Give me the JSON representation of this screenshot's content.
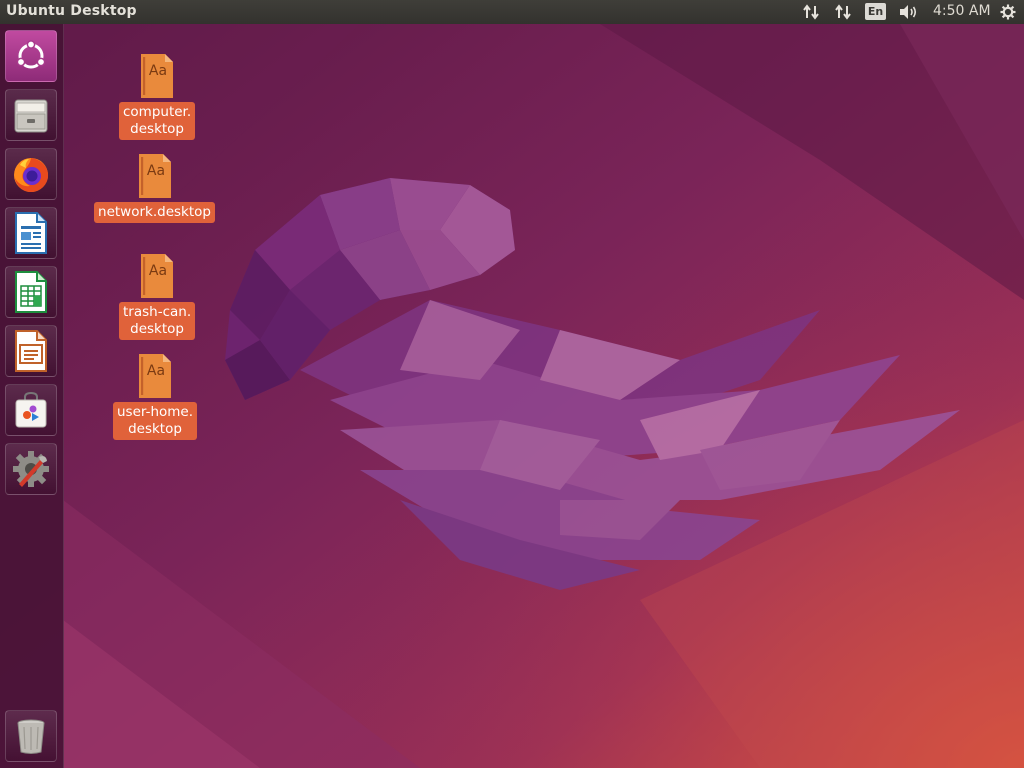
{
  "panel": {
    "title": "Ubuntu Desktop",
    "keyboard_layout": "En",
    "clock": "4:50 AM",
    "indicators": [
      "network-transfer-icon",
      "network-transfer-icon",
      "keyboard-layout",
      "volume-icon",
      "power-gear-icon"
    ]
  },
  "launcher": {
    "items": [
      {
        "name": "Ubuntu Dash",
        "icon": "ubuntu-logo-icon"
      },
      {
        "name": "Files",
        "icon": "file-cabinet-icon"
      },
      {
        "name": "Firefox Web Browser",
        "icon": "firefox-icon"
      },
      {
        "name": "LibreOffice Writer",
        "icon": "writer-document-icon"
      },
      {
        "name": "LibreOffice Calc",
        "icon": "calc-spreadsheet-icon"
      },
      {
        "name": "LibreOffice Impress",
        "icon": "impress-presentation-icon"
      },
      {
        "name": "Ubuntu Software",
        "icon": "software-bag-icon"
      },
      {
        "name": "System Settings",
        "icon": "settings-gear-icon"
      },
      {
        "name": "Trash",
        "icon": "trash-bin-icon"
      }
    ]
  },
  "desktop": {
    "icons": [
      {
        "label": "computer.\ndesktop",
        "icon": "font-file-icon"
      },
      {
        "label": "network.desktop",
        "icon": "font-file-icon"
      },
      {
        "label": "trash-can.\ndesktop",
        "icon": "font-file-icon"
      },
      {
        "label": "user-home.\ndesktop",
        "icon": "font-file-icon"
      }
    ],
    "icon_glyph_text": "Aa"
  },
  "colors": {
    "wallpaper_base": "#6e2452",
    "wallpaper_orange": "#e0583a",
    "panel_bg": "#3a3935",
    "launcher_bg": "#461234",
    "label_highlight": "#e0623a"
  }
}
